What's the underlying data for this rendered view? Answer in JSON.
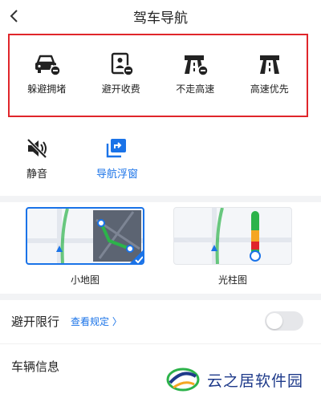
{
  "header": {
    "title": "驾车导航",
    "back_icon": "chevron-left-icon"
  },
  "route_prefs": [
    {
      "label": "躲避拥堵",
      "icon": "car-avoid-congestion-icon"
    },
    {
      "label": "避开收费",
      "icon": "toll-avoid-icon"
    },
    {
      "label": "不走高速",
      "icon": "highway-avoid-icon"
    },
    {
      "label": "高速优先",
      "icon": "highway-priority-icon"
    }
  ],
  "tools": {
    "mute_label": "静音",
    "float_label": "导航浮窗"
  },
  "map_options": {
    "small_map_label": "小地图",
    "light_bar_label": "光柱图",
    "selected": "小地图"
  },
  "limit_row": {
    "title": "避开限行",
    "link": "查看规定 〉",
    "toggle_on": false
  },
  "vehicle_row": {
    "title": "车辆信息"
  },
  "watermark": {
    "text": "云之居软件园"
  },
  "colors": {
    "accent": "#1a73e8",
    "highlight_border": "#e0262b",
    "route_green": "#2cb34a"
  }
}
